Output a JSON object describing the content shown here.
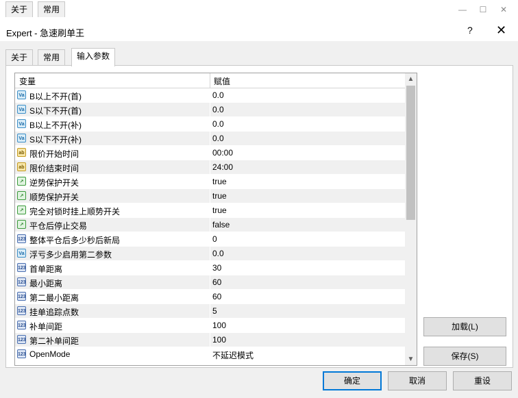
{
  "window": {
    "title": "Expert - 急速刷单王",
    "help": "?",
    "close": "✕",
    "minimize": "—",
    "maximize": "☐",
    "win_close": "✕"
  },
  "tabs": [
    {
      "label": "关于"
    },
    {
      "label": "常用"
    },
    {
      "label": "输入参数"
    }
  ],
  "table": {
    "headers": {
      "variable": "变量",
      "value": "赋值"
    },
    "rows": [
      {
        "icon": "Va",
        "name": "B以上不开(首)",
        "value": "0.0"
      },
      {
        "icon": "Va",
        "name": "S以下不开(首)",
        "value": "0.0"
      },
      {
        "icon": "Va",
        "name": "B以上不开(补)",
        "value": "0.0"
      },
      {
        "icon": "Va",
        "name": "S以下不开(补)",
        "value": "0.0"
      },
      {
        "icon": "ab",
        "name": "限价开始时间",
        "value": "00:00"
      },
      {
        "icon": "ab",
        "name": "限价结束时间",
        "value": "24:00"
      },
      {
        "icon": "bool",
        "name": "逆势保护开关",
        "value": "true"
      },
      {
        "icon": "bool",
        "name": "顺势保护开关",
        "value": "true"
      },
      {
        "icon": "bool",
        "name": "完全对锁时挂上顺势开关",
        "value": "true"
      },
      {
        "icon": "bool",
        "name": "平仓后停止交易",
        "value": "false"
      },
      {
        "icon": "123",
        "name": "整体平仓后多少秒后新局",
        "value": "0"
      },
      {
        "icon": "Va",
        "name": "浮亏多少启用第二参数",
        "value": "0.0"
      },
      {
        "icon": "123",
        "name": "首单距离",
        "value": "30"
      },
      {
        "icon": "123",
        "name": "最小距离",
        "value": "60"
      },
      {
        "icon": "123",
        "name": "第二最小距离",
        "value": "60"
      },
      {
        "icon": "123",
        "name": "挂单追踪点数",
        "value": "5"
      },
      {
        "icon": "123",
        "name": "补单间距",
        "value": "100"
      },
      {
        "icon": "123",
        "name": "第二补单间距",
        "value": "100"
      },
      {
        "icon": "123",
        "name": "OpenMode",
        "value": "不延迟模式"
      }
    ]
  },
  "icons": {
    "up": "▲",
    "down": "▼"
  },
  "buttons": {
    "load": "加载(L)",
    "save": "保存(S)",
    "ok": "确定",
    "cancel": "取消",
    "reset": "重设"
  },
  "colors": {
    "accent": "#0078d7",
    "alt_row": "#f0f0f0"
  }
}
